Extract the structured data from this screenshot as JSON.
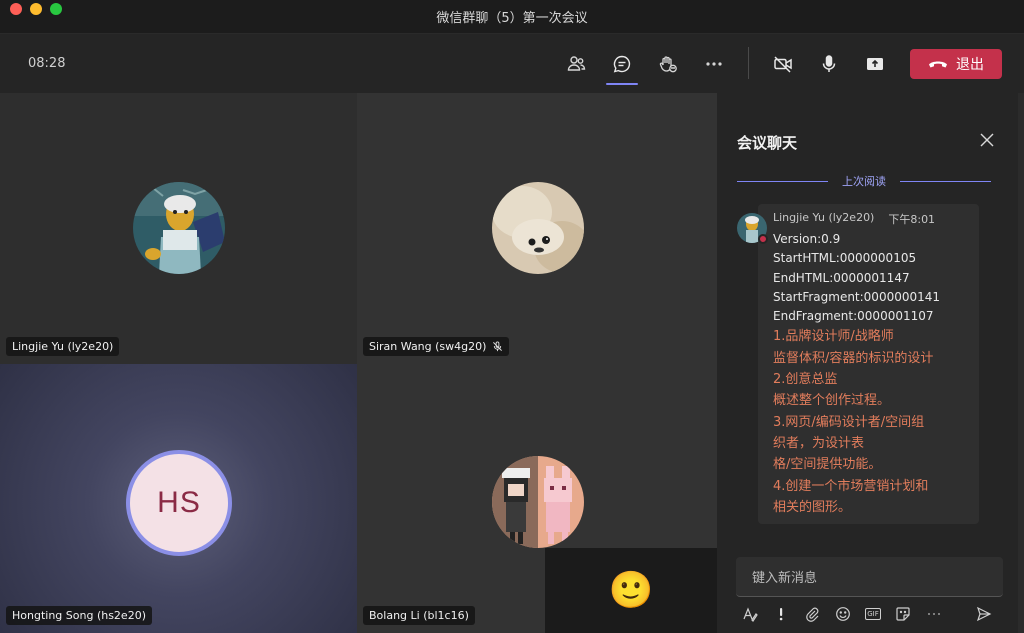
{
  "window": {
    "title": "微信群聊（5）第一次会议"
  },
  "toolbar": {
    "timer": "08:28",
    "leave_label": "退出",
    "icons": [
      "people-icon",
      "chat-icon",
      "raise-hand-icon",
      "more-icon",
      "camera-off-icon",
      "mic-icon",
      "share-icon",
      "phone-hangup-icon"
    ]
  },
  "participants": [
    {
      "name": "Lingjie Yu (ly2e20)",
      "muted": false
    },
    {
      "name": "Siran Wang (sw4g20)",
      "muted": true
    },
    {
      "name": "Hongting Song (hs2e20)",
      "initials": "HS",
      "muted": false
    },
    {
      "name": "Bolang Li (bl1c16)",
      "muted": false
    }
  ],
  "self_view": {
    "emoji": "🙂"
  },
  "chat": {
    "title": "会议聊天",
    "last_read_label": "上次阅读",
    "message": {
      "sender": "Lingjie Yu (ly2e20)",
      "time": "下午8:01",
      "lines": [
        "Version:0.9",
        "StartHTML:0000000105",
        "EndHTML:0000001147",
        "StartFragment:0000000141",
        "EndFragment:0000001107"
      ],
      "colored_lines": [
        "1.品牌设计师/战略师",
        "监督体积/容器的标识的设计",
        "2.创意总监",
        "概述整个创作过程。",
        "3.网页/编码设计者/空间组",
        "织者，为设计表",
        "格/空间提供功能。",
        "4.创建一个市场营销计划和",
        "相关的图形。"
      ],
      "colored_text_color": "#e27d5c"
    },
    "compose_placeholder": "键入新消息",
    "compose_tools": [
      "format-icon",
      "important-icon",
      "attach-icon",
      "emoji-icon",
      "gif-icon",
      "sticker-icon",
      "more-options-icon",
      "send-icon"
    ],
    "gif_label": "GIF"
  },
  "colors": {
    "accent": "#7f85f5",
    "leave": "#c4314b",
    "presence_busy": "#c4314b"
  }
}
